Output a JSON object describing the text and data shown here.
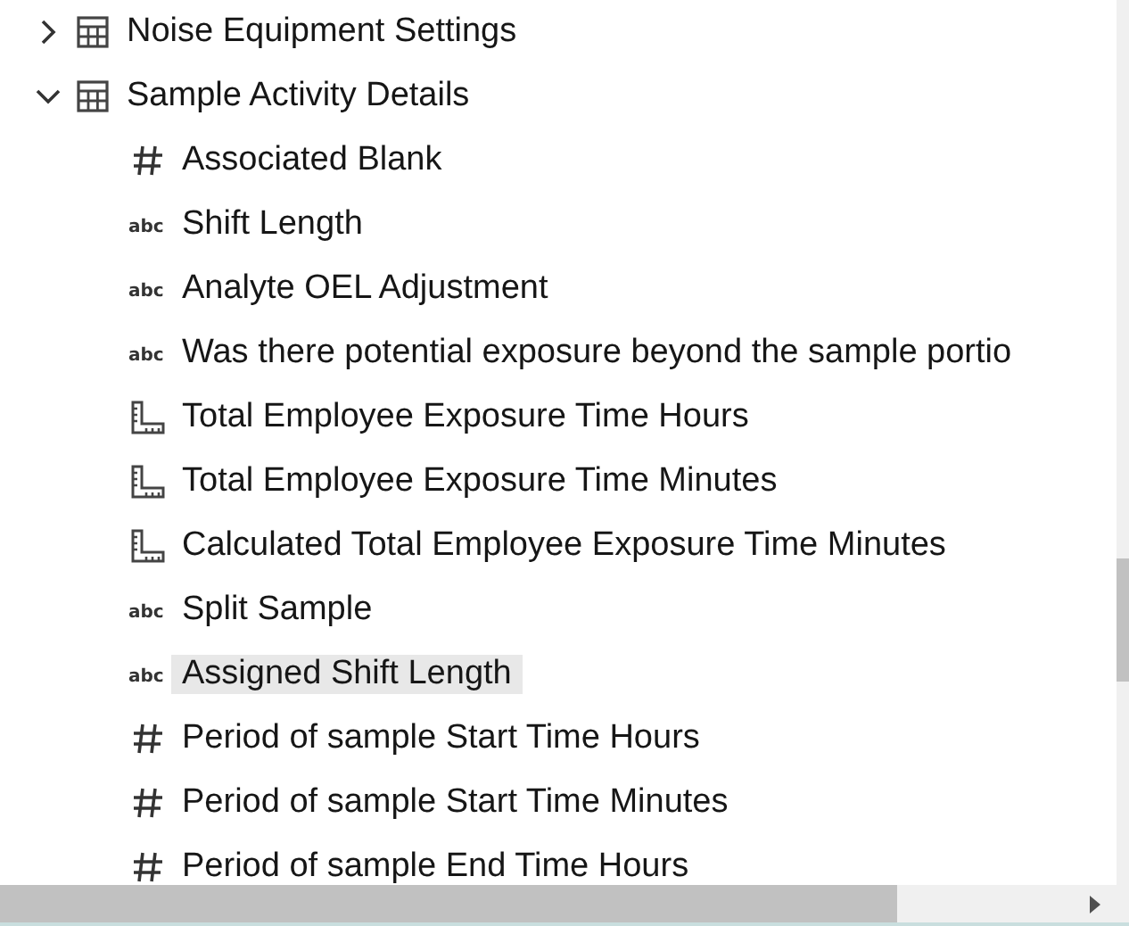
{
  "tree": [
    {
      "label": "Noise Equipment Settings",
      "kind": "table",
      "expanded": false,
      "selected": false
    },
    {
      "label": "Sample Activity Details",
      "kind": "table",
      "expanded": true,
      "selected": false,
      "children": [
        {
          "label": "Associated Blank",
          "kind": "number",
          "selected": false
        },
        {
          "label": "Shift Length",
          "kind": "text",
          "type_label": "abc",
          "selected": false
        },
        {
          "label": "Analyte OEL Adjustment",
          "kind": "text",
          "type_label": "abc",
          "selected": false
        },
        {
          "label": "Was there potential exposure beyond the sample portio",
          "kind": "text",
          "type_label": "abc",
          "selected": false
        },
        {
          "label": "Total Employee Exposure Time Hours",
          "kind": "measure",
          "selected": false
        },
        {
          "label": "Total Employee Exposure Time Minutes",
          "kind": "measure",
          "selected": false
        },
        {
          "label": "Calculated Total Employee Exposure Time Minutes",
          "kind": "measure",
          "selected": false
        },
        {
          "label": "Split Sample",
          "kind": "text",
          "type_label": "abc",
          "selected": false
        },
        {
          "label": "Assigned Shift Length",
          "kind": "text",
          "type_label": "abc",
          "selected": true
        },
        {
          "label": "Period of sample Start Time Hours",
          "kind": "number",
          "selected": false
        },
        {
          "label": "Period of sample Start Time Minutes",
          "kind": "number",
          "selected": false
        },
        {
          "label": "Period of sample End Time Hours",
          "kind": "number",
          "selected": false
        }
      ]
    }
  ]
}
